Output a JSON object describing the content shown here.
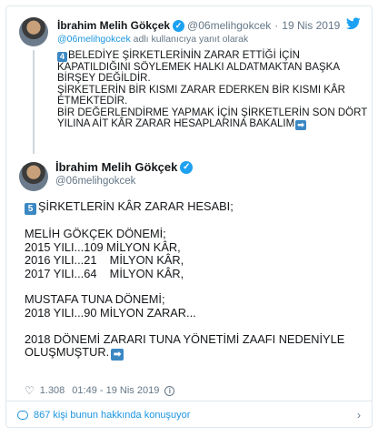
{
  "parent_tweet": {
    "author_name": "İbrahim Melih Gökçek",
    "handle": "@06melihgokcek",
    "date": "19 Nis 2019",
    "reply_to": {
      "prefix": "@06melihgokcek",
      "suffix": " adlı kullanıcıya yanıt olarak"
    },
    "number_emoji": "4",
    "lines": [
      "BELEDİYE ŞİRKETLERİNİN ZARAR ETTİĞİ İÇİN",
      "KAPATILDIĞINI SÖYLEMEK HALKI ALDATMAKTAN BAŞKA",
      "BİRŞEY DEĞİLDİR.",
      "ŞİRKETLERİN BİR KISMI ZARAR EDERKEN BİR KISMI KÂR",
      "ETMEKTEDİR.",
      "BİR DEĞERLENDİRME YAPMAK İÇİN ŞİRKETLERİN SON DÖRT",
      "YILINA AİT KÂR ZARAR HESAPLARINA BAKALIM"
    ]
  },
  "main_tweet": {
    "author_name": "İbrahim Melih Gökçek",
    "handle": "@06melihgokcek",
    "number_emoji": "5",
    "lines": [
      "ŞİRKETLERİN KÂR ZARAR HESABI;",
      "",
      "MELİH GÖKÇEK DÖNEMİ;",
      "2015 YILI...109 MİLYON KÂR,",
      "2016 YILI...21    MİLYON KÂR,",
      "2017 YILI...64    MİLYON KÂR,",
      "",
      "MUSTAFA TUNA DÖNEMİ;",
      "2018 YILI...90 MİLYON ZARAR...",
      "",
      "2018 DÖNEMİ ZARARI TUNA YÖNETİMİ ZAAFI NEDENİYLE",
      "OLUŞMUŞTUR."
    ],
    "likes": "1.308",
    "timestamp": "01:49 - 19 Nis 2019"
  },
  "footer": {
    "conversation_text": "867 kişi bunun hakkında konuşuyor"
  },
  "icons": {
    "verified": "verified-badge-icon",
    "bird": "twitter-bird-icon",
    "heart": "heart-icon",
    "info": "info-icon",
    "comment": "comment-bubble-icon",
    "chevron": "chevron-right-icon",
    "arrow": "right-arrow-emoji"
  },
  "colors": {
    "accent": "#1b95e0",
    "verified": "#1da1f2",
    "muted": "#657786",
    "emoji_blue": "#3b88c3"
  }
}
